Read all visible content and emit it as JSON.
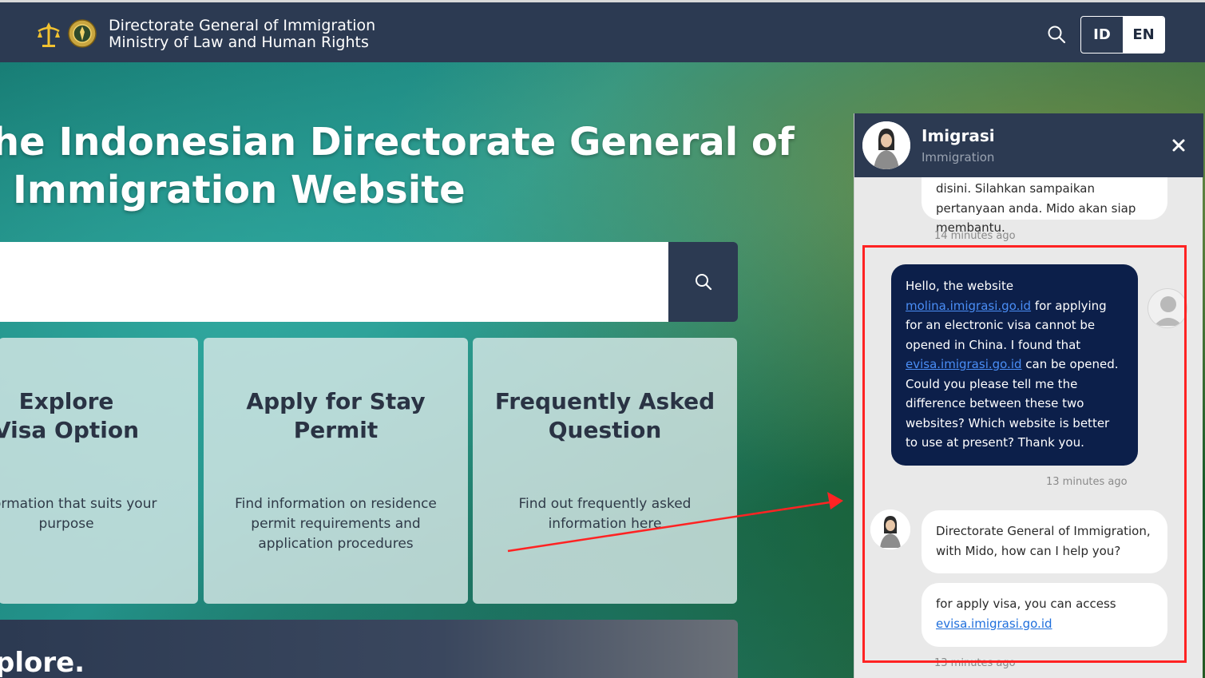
{
  "header": {
    "brand_line1": "Directorate General of Immigration",
    "brand_line2": "Ministry of Law and Human Rights",
    "lang_id": "ID",
    "lang_en": "EN"
  },
  "hero": {
    "title_line1": "he Indonesian Directorate General of",
    "title_line2": "Immigration Website"
  },
  "cards": [
    {
      "title": "Explore Visa Option",
      "desc": "information that suits your purpose"
    },
    {
      "title": "Apply for Stay Permit",
      "desc": "Find information on residence permit requirements and application procedures"
    },
    {
      "title": "Frequently Asked Question",
      "desc": "Find out frequently asked information here"
    }
  ],
  "explore": {
    "label": "plore."
  },
  "chat": {
    "name": "Imigrasi",
    "subtitle": "Immigration",
    "messages": {
      "greeting_tail": "disini. Silahkan sampaikan pertanyaan anda. Mido akan siap membantu.",
      "greeting_time": "14 minutes ago",
      "user_part1": "Hello, the website",
      "user_link1": "molina.imigrasi.go.id",
      "user_part2": " for applying for an electronic visa cannot be opened in China. I found that",
      "user_link2": "evisa.imigrasi.go.id",
      "user_part3": " can be opened. Could you please tell me the difference between these two websites? Which website is better to use at present? Thank you.",
      "user_time": "13 minutes ago",
      "bot1": "Directorate General of Immigration, with Mido, how can I help you?",
      "bot2_text": "for apply visa, you can access",
      "bot2_link": "evisa.imigrasi.go.id",
      "bot2_time": "13 minutes ago"
    }
  },
  "colors": {
    "header_bg": "#2c3a52",
    "user_bubble": "#0c1f4a",
    "highlight": "#ff2323"
  }
}
